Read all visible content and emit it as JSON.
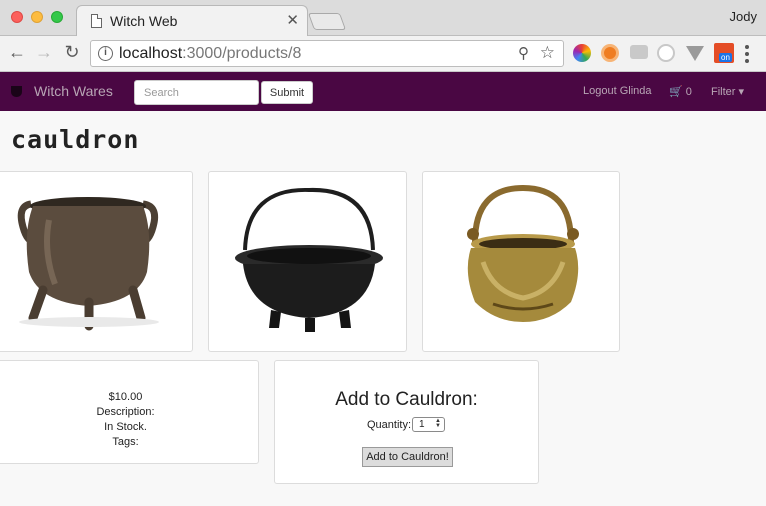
{
  "browser": {
    "tab_title": "Witch Web",
    "tab_close": "✕",
    "profile_name": "Jody",
    "url_host": "localhost",
    "url_path": ":3000/products/8",
    "info_glyph": "i",
    "ext_badge": "on",
    "icons": [
      "back-icon",
      "forward-icon",
      "reload-icon",
      "info-icon",
      "zoom-icon",
      "star-icon",
      "menu-icon"
    ]
  },
  "navbar": {
    "brand": "Witch Wares",
    "search_placeholder": "Search",
    "submit_label": "Submit",
    "logout": "Logout Glinda",
    "cart_count": "0",
    "filter": "Filter ▾",
    "colors": {
      "background": "#4a0743",
      "link": "#b8a6b5"
    }
  },
  "product": {
    "title": "cauldron",
    "price": "$10.00",
    "description": "Description:",
    "stock": "In Stock.",
    "tags": "Tags:",
    "images": [
      "bronze-tripod-cauldron",
      "black-iron-cauldron",
      "brass-handled-pot"
    ]
  },
  "add_panel": {
    "title": "Add to Cauldron:",
    "quantity_label": "Quantity:",
    "quantity_value": "1",
    "button": "Add to Cauldron!"
  }
}
